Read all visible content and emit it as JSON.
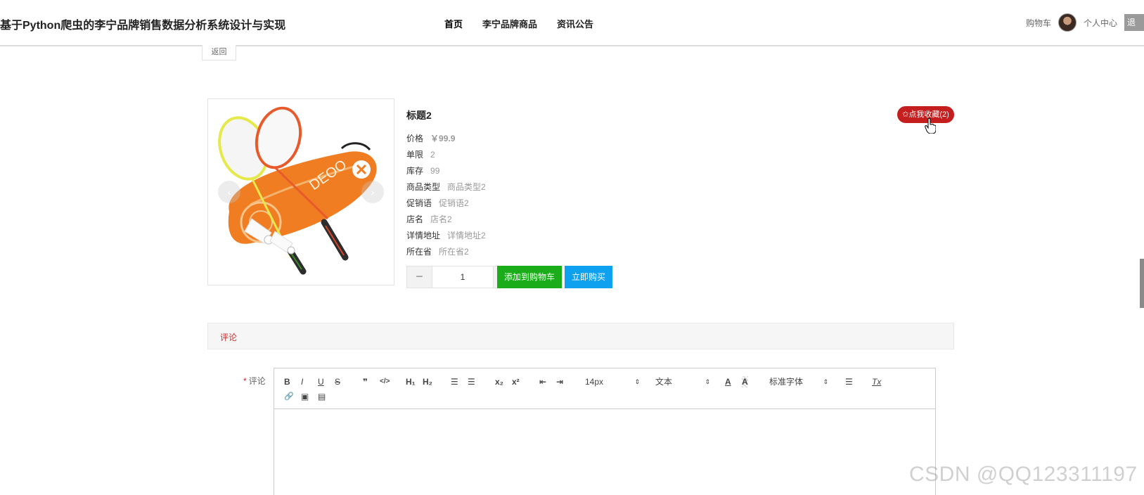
{
  "header": {
    "site_title": "基于Python爬虫的李宁品牌销售数据分析系统设计与实现",
    "nav": [
      "首页",
      "李宁品牌商品",
      "资讯公告"
    ],
    "cart_label": "购物车",
    "user_center_label": "个人中心",
    "logout_label": "退出"
  },
  "back_label": "返回",
  "product": {
    "title": "标题2",
    "fav_label": "✩点我收藏(2)",
    "fields": [
      {
        "label": "价格",
        "value": "￥99.9"
      },
      {
        "label": "单限",
        "value": "2"
      },
      {
        "label": "库存",
        "value": "99"
      },
      {
        "label": "商品类型",
        "value": "商品类型2"
      },
      {
        "label": "促销语",
        "value": "促销语2"
      },
      {
        "label": "店名",
        "value": "店名2"
      },
      {
        "label": "详情地址",
        "value": "详情地址2"
      },
      {
        "label": "所在省",
        "value": "所在省2"
      }
    ],
    "quantity": "1",
    "minus": "−",
    "plus": "+",
    "add_cart_label": "添加到购物车",
    "buy_now_label": "立即购买"
  },
  "comment": {
    "tab_label": "评论",
    "field_label": "评论",
    "required_mark": "*",
    "toolbar": {
      "bold": "B",
      "italic": "I",
      "underline": "U",
      "strike": "S",
      "quote": "❞",
      "code": "</>",
      "h1": "H₁",
      "h2": "H₂",
      "ordered": "☰",
      "bullet": "☰",
      "sub": "x₂",
      "sup": "x²",
      "outdent": "⇤",
      "indent": "⇥",
      "size_value": "14px",
      "header_value": "文本",
      "color": "A",
      "background": "A",
      "font_value": "标准字体",
      "align": "☰",
      "clean": "Tx",
      "link": "🔗",
      "image": "▣",
      "video": "▤"
    }
  },
  "watermark": "CSDN @QQ123311197"
}
